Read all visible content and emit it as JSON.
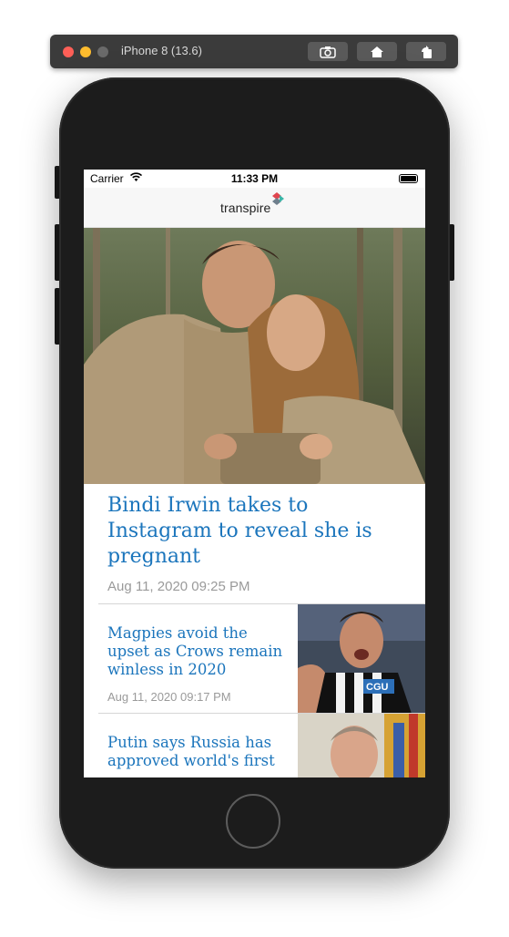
{
  "simulator": {
    "title": "iPhone 8 (13.6)",
    "buttons": [
      "camera-icon",
      "home-icon",
      "rotate-icon"
    ]
  },
  "status_bar": {
    "carrier": "Carrier",
    "time": "11:33 PM"
  },
  "nav": {
    "logo_text": "transpire"
  },
  "hero": {
    "title": "Bindi Irwin takes to Instagram to reveal she is pregnant",
    "date": "Aug 11, 2020 09:25 PM"
  },
  "articles": [
    {
      "title": "Magpies avoid the upset as Crows remain winless in 2020",
      "date": "Aug 11, 2020 09:17 PM",
      "thumb_badge": "CGU"
    },
    {
      "title": "Putin says Russia has approved world's first",
      "date": ""
    }
  ],
  "colors": {
    "headline": "#1b75bc",
    "date": "#9a9a9a",
    "device": "#1c1c1c"
  }
}
